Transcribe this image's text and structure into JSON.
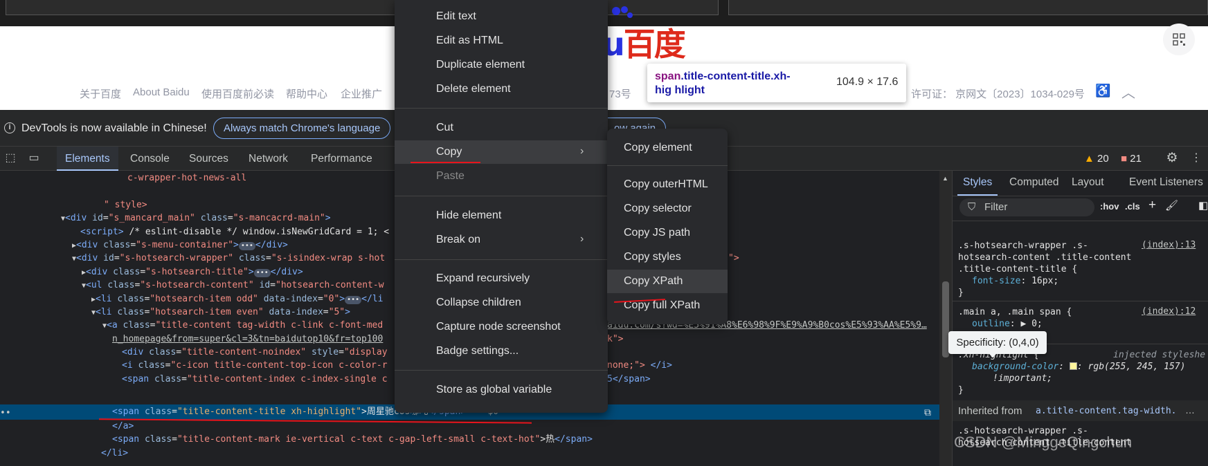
{
  "baidu": {
    "logo_text": "百度",
    "logo_prefix": "u",
    "footer_links": [
      "关于百度",
      "About Baidu",
      "使用百度前必读",
      "帮助中心",
      "企业推广"
    ],
    "footer_partial": "73号",
    "footer_license": "许可证：  京网文〔2023〕1034-029号"
  },
  "node_tooltip": {
    "tag": "span",
    "class_text": ".title-content-title.xh-hig hlight",
    "size": "104.9 × 17.6"
  },
  "infobar": {
    "message": "DevTools is now available in Chinese!",
    "match_button": "Always match Chrome's language",
    "partial_button": "ow again"
  },
  "tabs": [
    "Elements",
    "Console",
    "Sources",
    "Network",
    "Performance"
  ],
  "badges": {
    "warnings": "20",
    "issues": "21"
  },
  "dom_lines": [
    {
      "text": "c-wrapper-hot-news-all"
    },
    {
      "text": "\" style>"
    }
  ],
  "dom": {
    "l1": "c-wrapper-hot-news-all",
    "l2": "\" style>",
    "l3_tag": "<div ",
    "l3_a1": "id",
    "l3_v1": "\"s_mancard_main\"",
    "l3_a2": "class",
    "l3_v2": "\"s-mancacrd-main\"",
    "l3_end": ">",
    "l4_tag": "<script>",
    "l4_text": " /* eslint-disable */ window.isNewGridCard = 1; <",
    "l5_tag": "<div ",
    "l5_a": "class",
    "l5_v": "\"s-menu-container\"",
    "l5_end": ">",
    "l5_close": "</div>",
    "l6_tag": "<div ",
    "l6_a1": "id",
    "l6_v1": "\"s-hotsearch-wrapper\"",
    "l6_a2": "class",
    "l6_v2": "\"s-isindex-wrap s-hot",
    "l6_tail": "\">",
    "l7_tag": "<div ",
    "l7_a": "class",
    "l7_v": "\"s-hotsearch-title\"",
    "l7_end": ">",
    "l7_close": "</div>",
    "l8_tag": "<ul ",
    "l8_a1": "class",
    "l8_v1": "\"s-hotsearch-content\"",
    "l8_a2": "id",
    "l8_v2": "\"hotsearch-content-w",
    "l9_tag": "<li ",
    "l9_a1": "class",
    "l9_v1": "\"hotsearch-item odd\"",
    "l9_a2": "data-index",
    "l9_v2": "\"0\"",
    "l9_end": ">",
    "l9_close": "</li",
    "l10_tag": "<li ",
    "l10_a1": "class",
    "l10_v1": "\"hotsearch-item even\"",
    "l10_a2": "data-index",
    "l10_v2": "\"5\"",
    "l10_end": ">",
    "l11_tag": "<a ",
    "l11_a": "class",
    "l11_v": "\"title-content tag-width c-link c-font-med",
    "l11_url": "aidu.com/s?wd=%E5%91%A8%E6%98%9F%E9%A9%B0cos%E5%93%AA%E5%9…",
    "l12_url": "n_homepage&from=super&cl=3&tn=baidutop10&fr=top100",
    "l12_tail": "k\">",
    "l13_tag": "<div ",
    "l13_a1": "class",
    "l13_v1": "\"title-content-noindex\"",
    "l13_a2": "style",
    "l13_v2": "\"display",
    "l14_tag": "<i ",
    "l14_a": "class",
    "l14_v": "\"c-icon title-content-top-icon c-color-r",
    "l14_tail": "none;\">",
    "l14_close": "</i>",
    "l15_tag": "<span ",
    "l15_a": "class",
    "l15_v": "\"title-content-index c-index-single c",
    "l15_tail": "5</span>",
    "l16_tag": "<span ",
    "l16_a": "class",
    "l16_v": "\"title-content-title xh-highlight\"",
    "l16_text": ">周星驰cos哪吒",
    "l16_close": "</span>",
    "l16_eq": " == $0",
    "l17_close": "</a>",
    "l18_tag": "<span ",
    "l18_a": "class",
    "l18_v": "\"title-content-mark ie-vertical c-text c-gap-left-small c-text-hot\"",
    "l18_text": ">热",
    "l18_close": "</span>",
    "l19_close": "</li>"
  },
  "styles_tabs": [
    "Styles",
    "Computed",
    "Layout",
    "Event Listeners"
  ],
  "styles": {
    "filter_placeholder": "Filter",
    "hov": ":hov",
    "cls": ".cls",
    "specificity_tip": "Specificity: (0,4,0)",
    "rule1_sel1": ".s-hotsearch-wrapper .s-",
    "rule1_sel2": "hotsearch-content .title-content",
    "rule1_sel3": ".title-content-title {",
    "rule1_prop": "font-size",
    "rule1_val": ": 16px;",
    "rule1_src": "(index):13",
    "rule2_sel": ".main a, .main span {",
    "rule2_prop": "outline",
    "rule2_val": ": ▶ 0;",
    "rule2_src": "(index):12",
    "rule3_sel": ".xh-highlight {",
    "rule3_note": "injected styleshe",
    "rule3_prop": "background-color",
    "rule3_val": ": rgb(255, 245, 157)",
    "rule3_important": "!important;",
    "close_brace": "}",
    "inherited_label": "Inherited from",
    "inherited_link": "a.title-content.tag-width.",
    "partial_rule1": ".s-hotsearch-wrapper .s-",
    "partial_rule2": "hotsearch-content .title-content"
  },
  "context_menu": {
    "items": [
      "Edit text",
      "Edit as HTML",
      "Duplicate element",
      "Delete element",
      "Cut",
      "Copy",
      "Paste",
      "Hide element",
      "Break on",
      "Expand recursively",
      "Collapse children",
      "Capture node screenshot",
      "Badge settings...",
      "Store as global variable"
    ]
  },
  "copy_submenu": {
    "items": [
      "Copy element",
      "Copy outerHTML",
      "Copy selector",
      "Copy JS path",
      "Copy styles",
      "Copy XPath",
      "Copy full XPath"
    ]
  },
  "watermark": "CSDN @MinggeQingchun",
  "colors": {
    "accent": "#a8c7fa",
    "selection": "#004a77",
    "annotation": "#e8141c",
    "baidu_red": "#de2a1b"
  }
}
